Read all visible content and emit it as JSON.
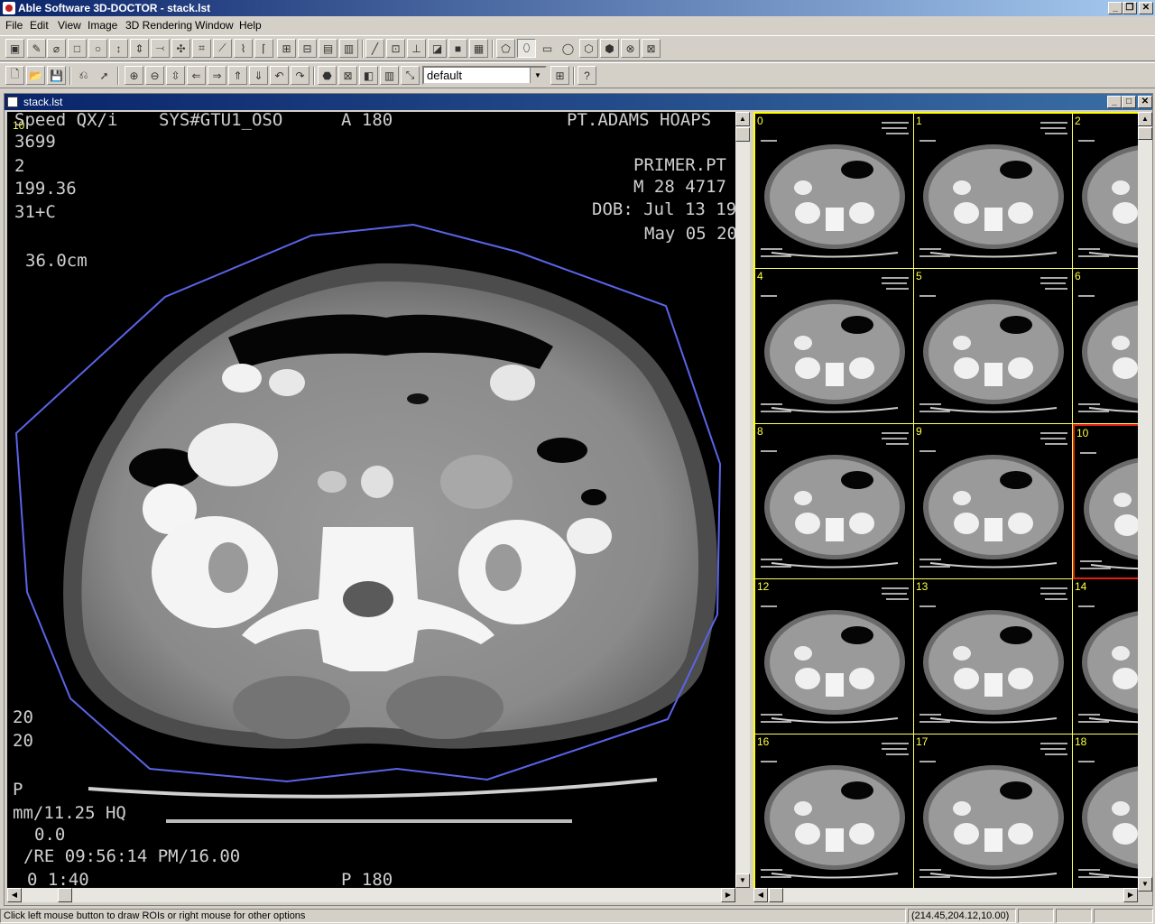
{
  "window": {
    "title": "Able Software 3D-DOCTOR - stack.lst"
  },
  "menu": [
    "File",
    "Edit",
    "View",
    "Image",
    "3D Rendering",
    "Window",
    "Help"
  ],
  "toolbar": {
    "profile_value": "default"
  },
  "document": {
    "title": "stack.lst"
  },
  "image_view": {
    "slice_index": "10",
    "overlay_left": [
      "Speed QX/i",
      "3699",
      "2",
      "199.36",
      "31+C",
      "36.0cm"
    ],
    "overlay_top": [
      "SYS#GTU1_OSO",
      "A 180"
    ],
    "overlay_right": [
      "PT.ADAMS HOAPS",
      "PRIMER.PT",
      "M 28  4717",
      "DOB: Jul 13 19",
      "May 05 20"
    ],
    "overlay_bottom": [
      "20",
      "20",
      "P",
      "mm/11.25 HQ",
      "0.0",
      "/RE 09:56:14 PM/16.00",
      "0 1:40",
      "P 180"
    ],
    "roi_color": "#5a64e8"
  },
  "thumbnails": [
    {
      "index": "0"
    },
    {
      "index": "1"
    },
    {
      "index": "2"
    },
    {
      "index": "4"
    },
    {
      "index": "5"
    },
    {
      "index": "6"
    },
    {
      "index": "8"
    },
    {
      "index": "9"
    },
    {
      "index": "10",
      "selected": true
    },
    {
      "index": "12"
    },
    {
      "index": "13"
    },
    {
      "index": "14"
    },
    {
      "index": "16"
    },
    {
      "index": "17"
    },
    {
      "index": "18"
    }
  ],
  "statusbar": {
    "hint": "Click left mouse button to draw ROIs or right mouse for other options",
    "coords": "(214.45,204.12,10.00)"
  }
}
